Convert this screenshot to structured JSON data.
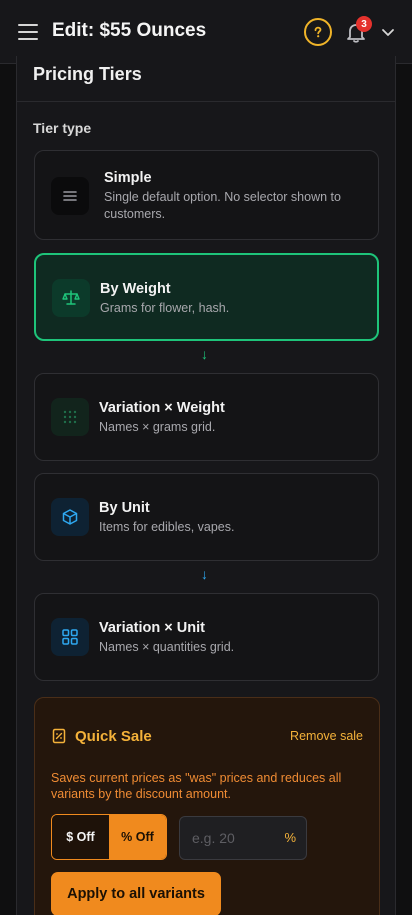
{
  "header": {
    "title": "Edit: $55 Ounces",
    "menu_icon": "hamburger-icon",
    "help_icon": "help-icon",
    "notifications": {
      "icon": "bell-icon",
      "count": "3"
    },
    "account_icon": "chevron-down-icon",
    "help_color": "#f0b429"
  },
  "pricing": {
    "title": "Pricing Tiers",
    "tier_type_label": "Tier type",
    "tiers": [
      {
        "title": "Simple",
        "description": "Single default option. No selector shown to customers.",
        "icon": "list-icon",
        "selected": false
      },
      {
        "title": "By Weight",
        "description": "Grams for flower, hash.",
        "icon": "scale-icon",
        "selected": true
      },
      {
        "title": "Variation × Weight",
        "description": "Names × grams grid.",
        "icon": "grid-dots-icon",
        "selected": false
      },
      {
        "title": "By Unit",
        "description": "Items for edibles, vapes.",
        "icon": "box-icon",
        "selected": false
      },
      {
        "title": "Variation × Unit",
        "description": "Names × quantities grid.",
        "icon": "grid-squares-icon",
        "selected": false
      }
    ],
    "arrows": [
      "↓",
      "↓"
    ]
  },
  "quick_sale": {
    "title": "Quick Sale",
    "icon": "tag-icon",
    "remove_label": "Remove sale",
    "description": "Saves current prices as \"was\" prices and reduces all variants by the discount amount.",
    "toggle": {
      "options": [
        "$ Off",
        "% Off"
      ],
      "selected": "% Off"
    },
    "discount_placeholder": "e.g. 20",
    "unit": "%",
    "apply_label": "Apply to all variants"
  },
  "colors": {
    "accent_green": "#1ec47a",
    "accent_orange": "#f08a1e",
    "accent_blue": "#2ea8f0",
    "badge_red": "#e5322d"
  }
}
